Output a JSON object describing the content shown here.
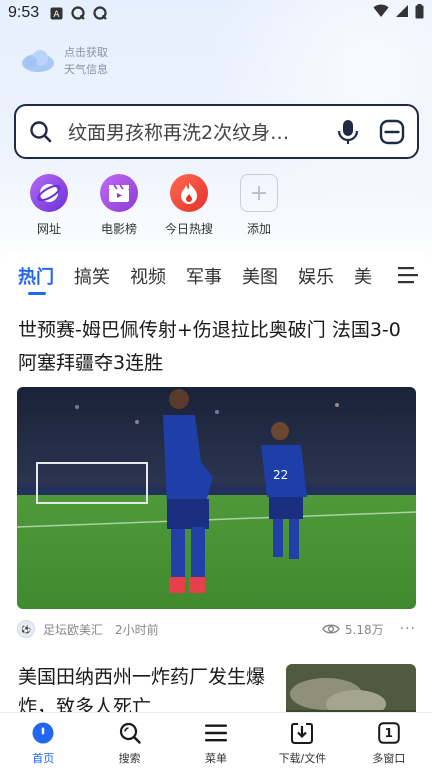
{
  "status_bar": {
    "time": "9:53"
  },
  "weather": {
    "line1": "点击获取",
    "line2": "天气信息"
  },
  "search": {
    "query": "纹面男孩称再洗2次纹身…"
  },
  "shortcuts": [
    {
      "label": "网址"
    },
    {
      "label": "电影榜"
    },
    {
      "label": "今日热搜"
    },
    {
      "label": "添加"
    }
  ],
  "tabs": [
    "热门",
    "搞笑",
    "视频",
    "军事",
    "美图",
    "娱乐",
    "美"
  ],
  "article1": {
    "title": "世预赛-姆巴佩传射+伤退拉比奥破门 法国3-0阿塞拜疆夺3连胜",
    "source": "足坛欧美汇",
    "time": "2小时前",
    "views": "5.18万",
    "more": "···"
  },
  "article2": {
    "title": "美国田纳西州一炸药厂发生爆炸，致多人死亡"
  },
  "bottom_nav": [
    {
      "label": "首页"
    },
    {
      "label": "搜索"
    },
    {
      "label": "菜单"
    },
    {
      "label": "下载/文件"
    },
    {
      "label": "多窗口"
    }
  ],
  "window_count": "1",
  "colors": {
    "accent": "#2366f0",
    "search_border": "#1f2a44"
  }
}
